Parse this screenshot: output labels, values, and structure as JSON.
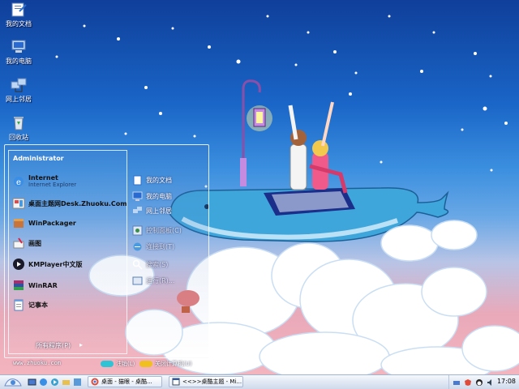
{
  "desktop_icons": [
    {
      "label": "我的文档",
      "icon": "my-documents-icon"
    },
    {
      "label": "我的电脑",
      "icon": "my-computer-icon"
    },
    {
      "label": "网上邻居",
      "icon": "network-places-icon"
    },
    {
      "label": "回收站",
      "icon": "recycle-bin-icon"
    }
  ],
  "start_menu": {
    "user": "Administrator",
    "pinned": [
      {
        "name": "Internet",
        "sub": "Internet Explorer",
        "icon": "ie-icon"
      },
      {
        "name": "桌面主题网Desk.Zhuoku.Com",
        "sub": "",
        "icon": "theme-site-icon"
      },
      {
        "name": "WinPackager",
        "sub": "",
        "icon": "packager-icon"
      },
      {
        "name": "画图",
        "sub": "",
        "icon": "paint-icon"
      },
      {
        "name": "KMPlayer中文版",
        "sub": "",
        "icon": "kmplayer-icon"
      },
      {
        "name": "WinRAR",
        "sub": "",
        "icon": "winrar-icon"
      },
      {
        "name": "记事本",
        "sub": "",
        "icon": "notepad-icon"
      }
    ],
    "places": [
      {
        "label": "我的文档",
        "icon": "my-documents-icon"
      },
      {
        "label": "我的电脑",
        "icon": "my-computer-icon"
      },
      {
        "label": "网上邻居",
        "icon": "network-places-icon"
      },
      {
        "label": "控制面板(C)",
        "icon": "control-panel-icon"
      },
      {
        "label": "连接到(T)",
        "icon": "connect-icon"
      },
      {
        "label": "搜索(S)",
        "icon": "search-icon"
      },
      {
        "label": "运行(R)...",
        "icon": "run-icon"
      }
    ],
    "all_programs": "所有程序(P)",
    "site": "www.zhuoku.com",
    "logoff": "注销(L)",
    "shutdown": "关闭计算机(U)"
  },
  "taskbar": {
    "tasks": [
      {
        "label": "桌面 - 猫眼 - 桌酷...",
        "icon": "chrome-icon"
      },
      {
        "label": "<<>>桌酷主题 - Mi...",
        "icon": "window-icon"
      }
    ],
    "clock": "17:08"
  },
  "colors": {
    "sky_top": "#0f3f9a",
    "sky_bottom": "#f4b4be",
    "logoff": "#2ec4d6",
    "shutdown": "#f0c020"
  }
}
